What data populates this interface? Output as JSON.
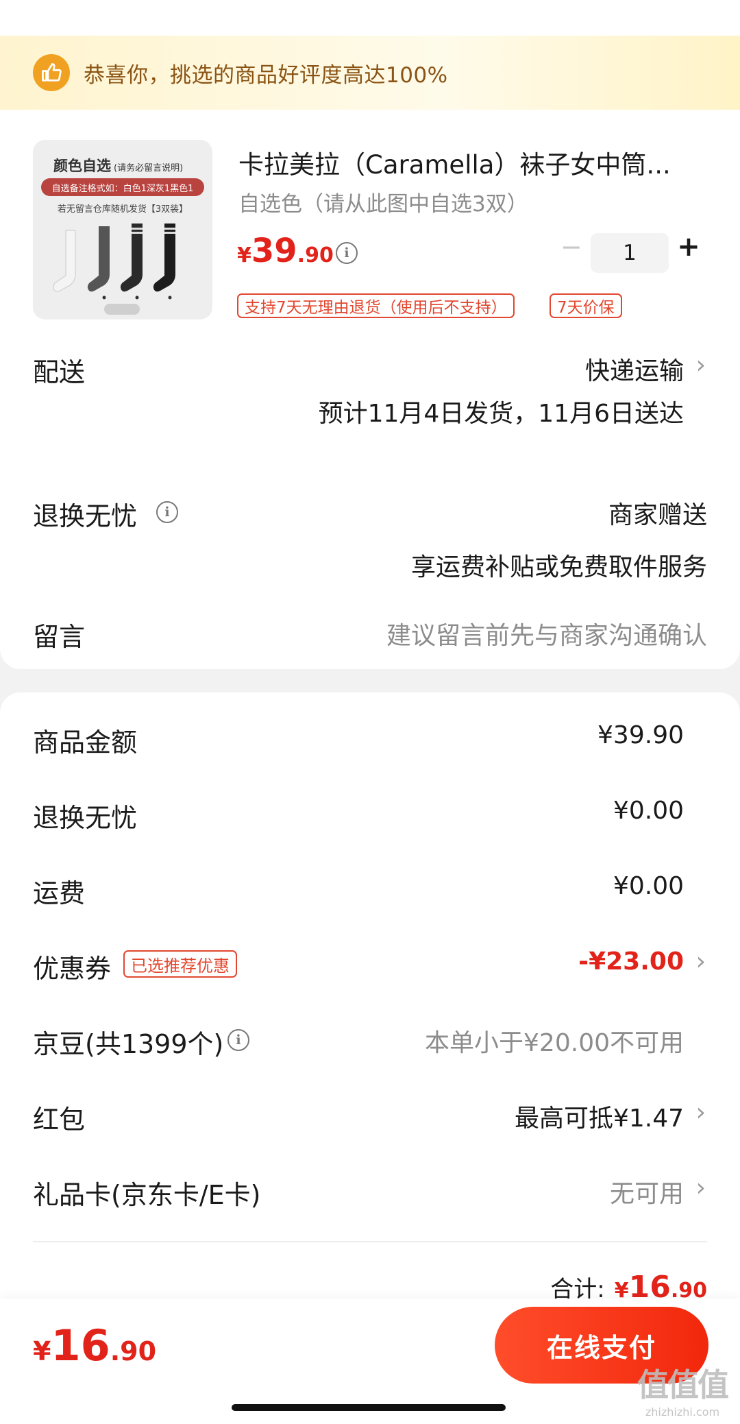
{
  "banner": {
    "text": "恭喜你，挑选的商品好评度高达100%"
  },
  "product": {
    "title": "卡拉美拉（Caramella）袜子女中筒...",
    "spec": "自选色（请从此图中自选3双）",
    "price": {
      "currency": "¥",
      "integer": "39",
      "decimal": ".90"
    },
    "quantity": "1",
    "image": {
      "heading": "颜色自选",
      "heading_note": "(请务必留言说明)",
      "red_bar": "自选备注格式如：白色1深灰1黑色1",
      "note": "若无留言仓库随机发货【3双装】",
      "sock_colors": [
        "#f2f2f2",
        "#555555",
        "#2a2a2a",
        "#1c1c1c"
      ]
    },
    "tags": [
      "支持7天无理由退货（使用后不支持）",
      "7天价保"
    ]
  },
  "delivery": {
    "label": "配送",
    "method": "快递运输",
    "estimate": "预计11月4日发货，11月6日送达"
  },
  "returns": {
    "label": "退换无忧",
    "value": "商家赠送",
    "sub": "享运费补贴或免费取件服务"
  },
  "message": {
    "label": "留言",
    "placeholder": "建议留言前先与商家沟通确认"
  },
  "summary": {
    "goods_amount": {
      "label": "商品金额",
      "value": "¥39.90"
    },
    "returns_fee": {
      "label": "退换无忧",
      "value": "¥0.00"
    },
    "shipping": {
      "label": "运费",
      "value": "¥0.00"
    },
    "coupon": {
      "label": "优惠券",
      "tag": "已选推荐优惠",
      "value": "-¥23.00"
    },
    "jingdou": {
      "label": "京豆(共1399个)",
      "value": "本单小于¥20.00不可用"
    },
    "red_packet": {
      "label": "红包",
      "value": "最高可抵¥1.47"
    },
    "gift_card": {
      "label": "礼品卡(京东卡/E卡)",
      "value": "无可用"
    },
    "total": {
      "label": "合计:",
      "currency": "¥",
      "integer": "16",
      "decimal": ".90"
    }
  },
  "bottom": {
    "currency": "¥",
    "integer": "16",
    "decimal": ".90",
    "pay_button": "在线支付"
  },
  "watermark": {
    "logo": "值值值",
    "site": "zhizhizhi.com"
  },
  "colors": {
    "accent": "#e2231a",
    "button": "#f2270c",
    "banner_icon": "#f0a121",
    "banner_text": "#8a5414"
  }
}
